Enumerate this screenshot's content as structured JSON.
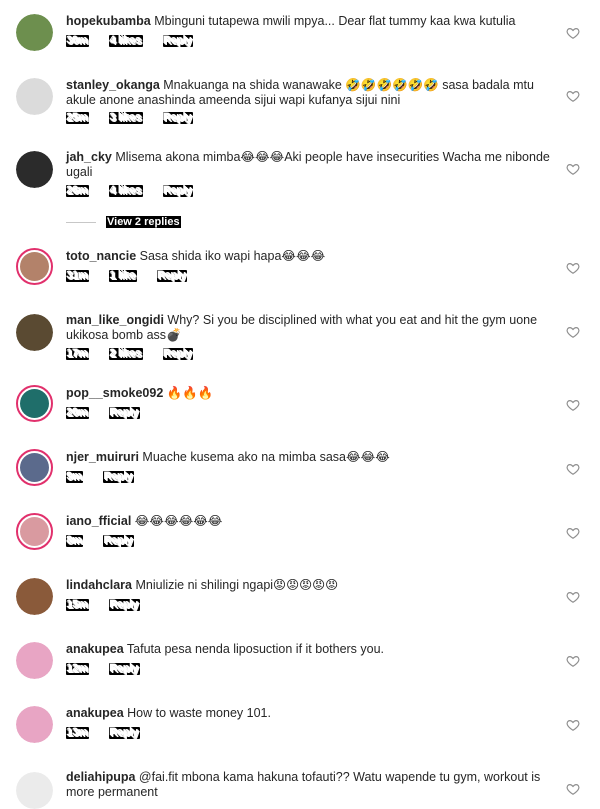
{
  "comments": [
    {
      "username": "hopekubamba",
      "text": "Mbinguni tutapewa mwili mpya... Dear flat tummy kaa kwa kutulia",
      "time": "30m",
      "likes": "4 likes",
      "reply": "Reply",
      "avatar_color": "#6d8f4e"
    },
    {
      "username": "stanley_okanga",
      "text": "Mnakuanga na shida wanawake 🤣🤣🤣🤣🤣🤣 sasa badala mtu akule anone anashinda ameenda sijui wapi kufanya sijui nini",
      "time": "25m",
      "likes": "3 likes",
      "reply": "Reply",
      "avatar_color": "#dbdbdb"
    },
    {
      "username": "jah_cky",
      "text": "Mlisema akona mimba😂😂😂Aki people have insecurities Wacha me nibonde ugali",
      "time": "26m",
      "likes": "4 likes",
      "reply": "Reply",
      "avatar_color": "#2b2b2b",
      "view_replies": "View 2 replies"
    },
    {
      "username": "toto_nancie",
      "text": "Sasa shida iko wapi hapa😂😂😂",
      "time": "31m",
      "likes": "1 like",
      "reply": "Reply",
      "avatar_color": "#b3826a"
    },
    {
      "username": "man_like_ongidi",
      "text": "Why? Si you be disciplined with what you eat and hit the gym uone ukikosa  bomb ass💣",
      "time": "17m",
      "likes": "2 likes",
      "reply": "Reply",
      "avatar_color": "#5a4a32"
    },
    {
      "username": "pop__smoke092",
      "text": "🔥🔥🔥",
      "time": "20m",
      "likes": "",
      "reply": "Reply",
      "avatar_color": "#1f6e6a"
    },
    {
      "username": "njer_muiruri",
      "text": "Muache kusema ako na mimba sasa😂😂😂",
      "time": "9m",
      "likes": "",
      "reply": "Reply",
      "avatar_color": "#5b6a8c"
    },
    {
      "username": "iano_fficial",
      "text": "😂😂😂😂😂😂",
      "time": "8m",
      "likes": "",
      "reply": "Reply",
      "avatar_color": "#d99aa0"
    },
    {
      "username": "lindahclara",
      "text": "Mniulizie ni shilingi ngapi😡😡😡😡😡",
      "time": "15m",
      "likes": "",
      "reply": "Reply",
      "avatar_color": "#8a5a3a"
    },
    {
      "username": "anakupea",
      "text": "Tafuta pesa nenda liposuction if it bothers you.",
      "time": "12m",
      "likes": "",
      "reply": "Reply",
      "avatar_color": "#e8a5c4"
    },
    {
      "username": "anakupea",
      "text": "How to waste money 101.",
      "time": "13m",
      "likes": "",
      "reply": "Reply",
      "avatar_color": "#e8a5c4"
    },
    {
      "username": "deliahipupa",
      "text": "@fai.fit mbona kama hakuna tofauti?? Watu wapende tu gym, workout is more permanent",
      "time": "",
      "likes": "",
      "reply": "",
      "avatar_color": "#ebebeb"
    }
  ],
  "colors": {
    "story_ring": "#e1306c",
    "heart_stroke": "#8e8e8e"
  }
}
